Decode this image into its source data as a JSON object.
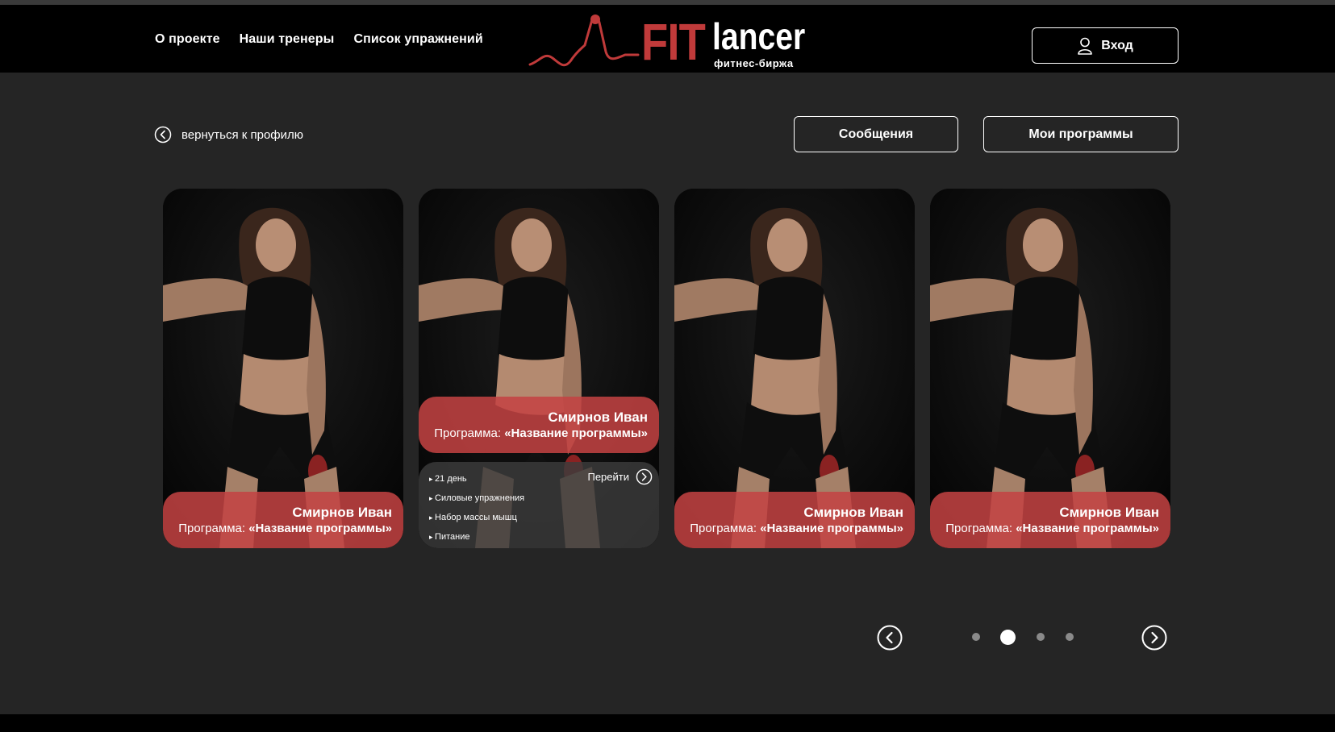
{
  "nav": {
    "items": [
      {
        "label": "О проекте"
      },
      {
        "label": "Наши тренеры"
      },
      {
        "label": "Список упражнений"
      }
    ]
  },
  "logo": {
    "fit": "FIT",
    "lancer": "lancer",
    "sub": "фитнес-биржа"
  },
  "header": {
    "login_label": "Вход"
  },
  "back": {
    "label": "вернуться к профилю"
  },
  "actions": {
    "messages_label": "Сообщения",
    "programs_label": "Мои программы"
  },
  "cards": [
    {
      "name": "Смирнов Иван",
      "prog_prefix": "Программа: ",
      "prog_name": "«Название программы»"
    },
    {
      "name": "Смирнов Иван",
      "prog_prefix": "Программа: ",
      "prog_name": "«Название программы»",
      "details": [
        "21 день",
        "Силовые упражнения",
        "Набор массы мышц",
        "Питание"
      ],
      "go_label": "Перейти"
    },
    {
      "name": "Смирнов Иван",
      "prog_prefix": "Программа: ",
      "prog_name": "«Название программы»"
    },
    {
      "name": "Смирнов Иван",
      "prog_prefix": "Программа: ",
      "prog_name": "«Название программы»"
    }
  ],
  "pager": {
    "page_count": 4,
    "active_page": 2
  },
  "colors": {
    "accent": "#c03a3a",
    "background": "#252525",
    "header": "#000000"
  }
}
